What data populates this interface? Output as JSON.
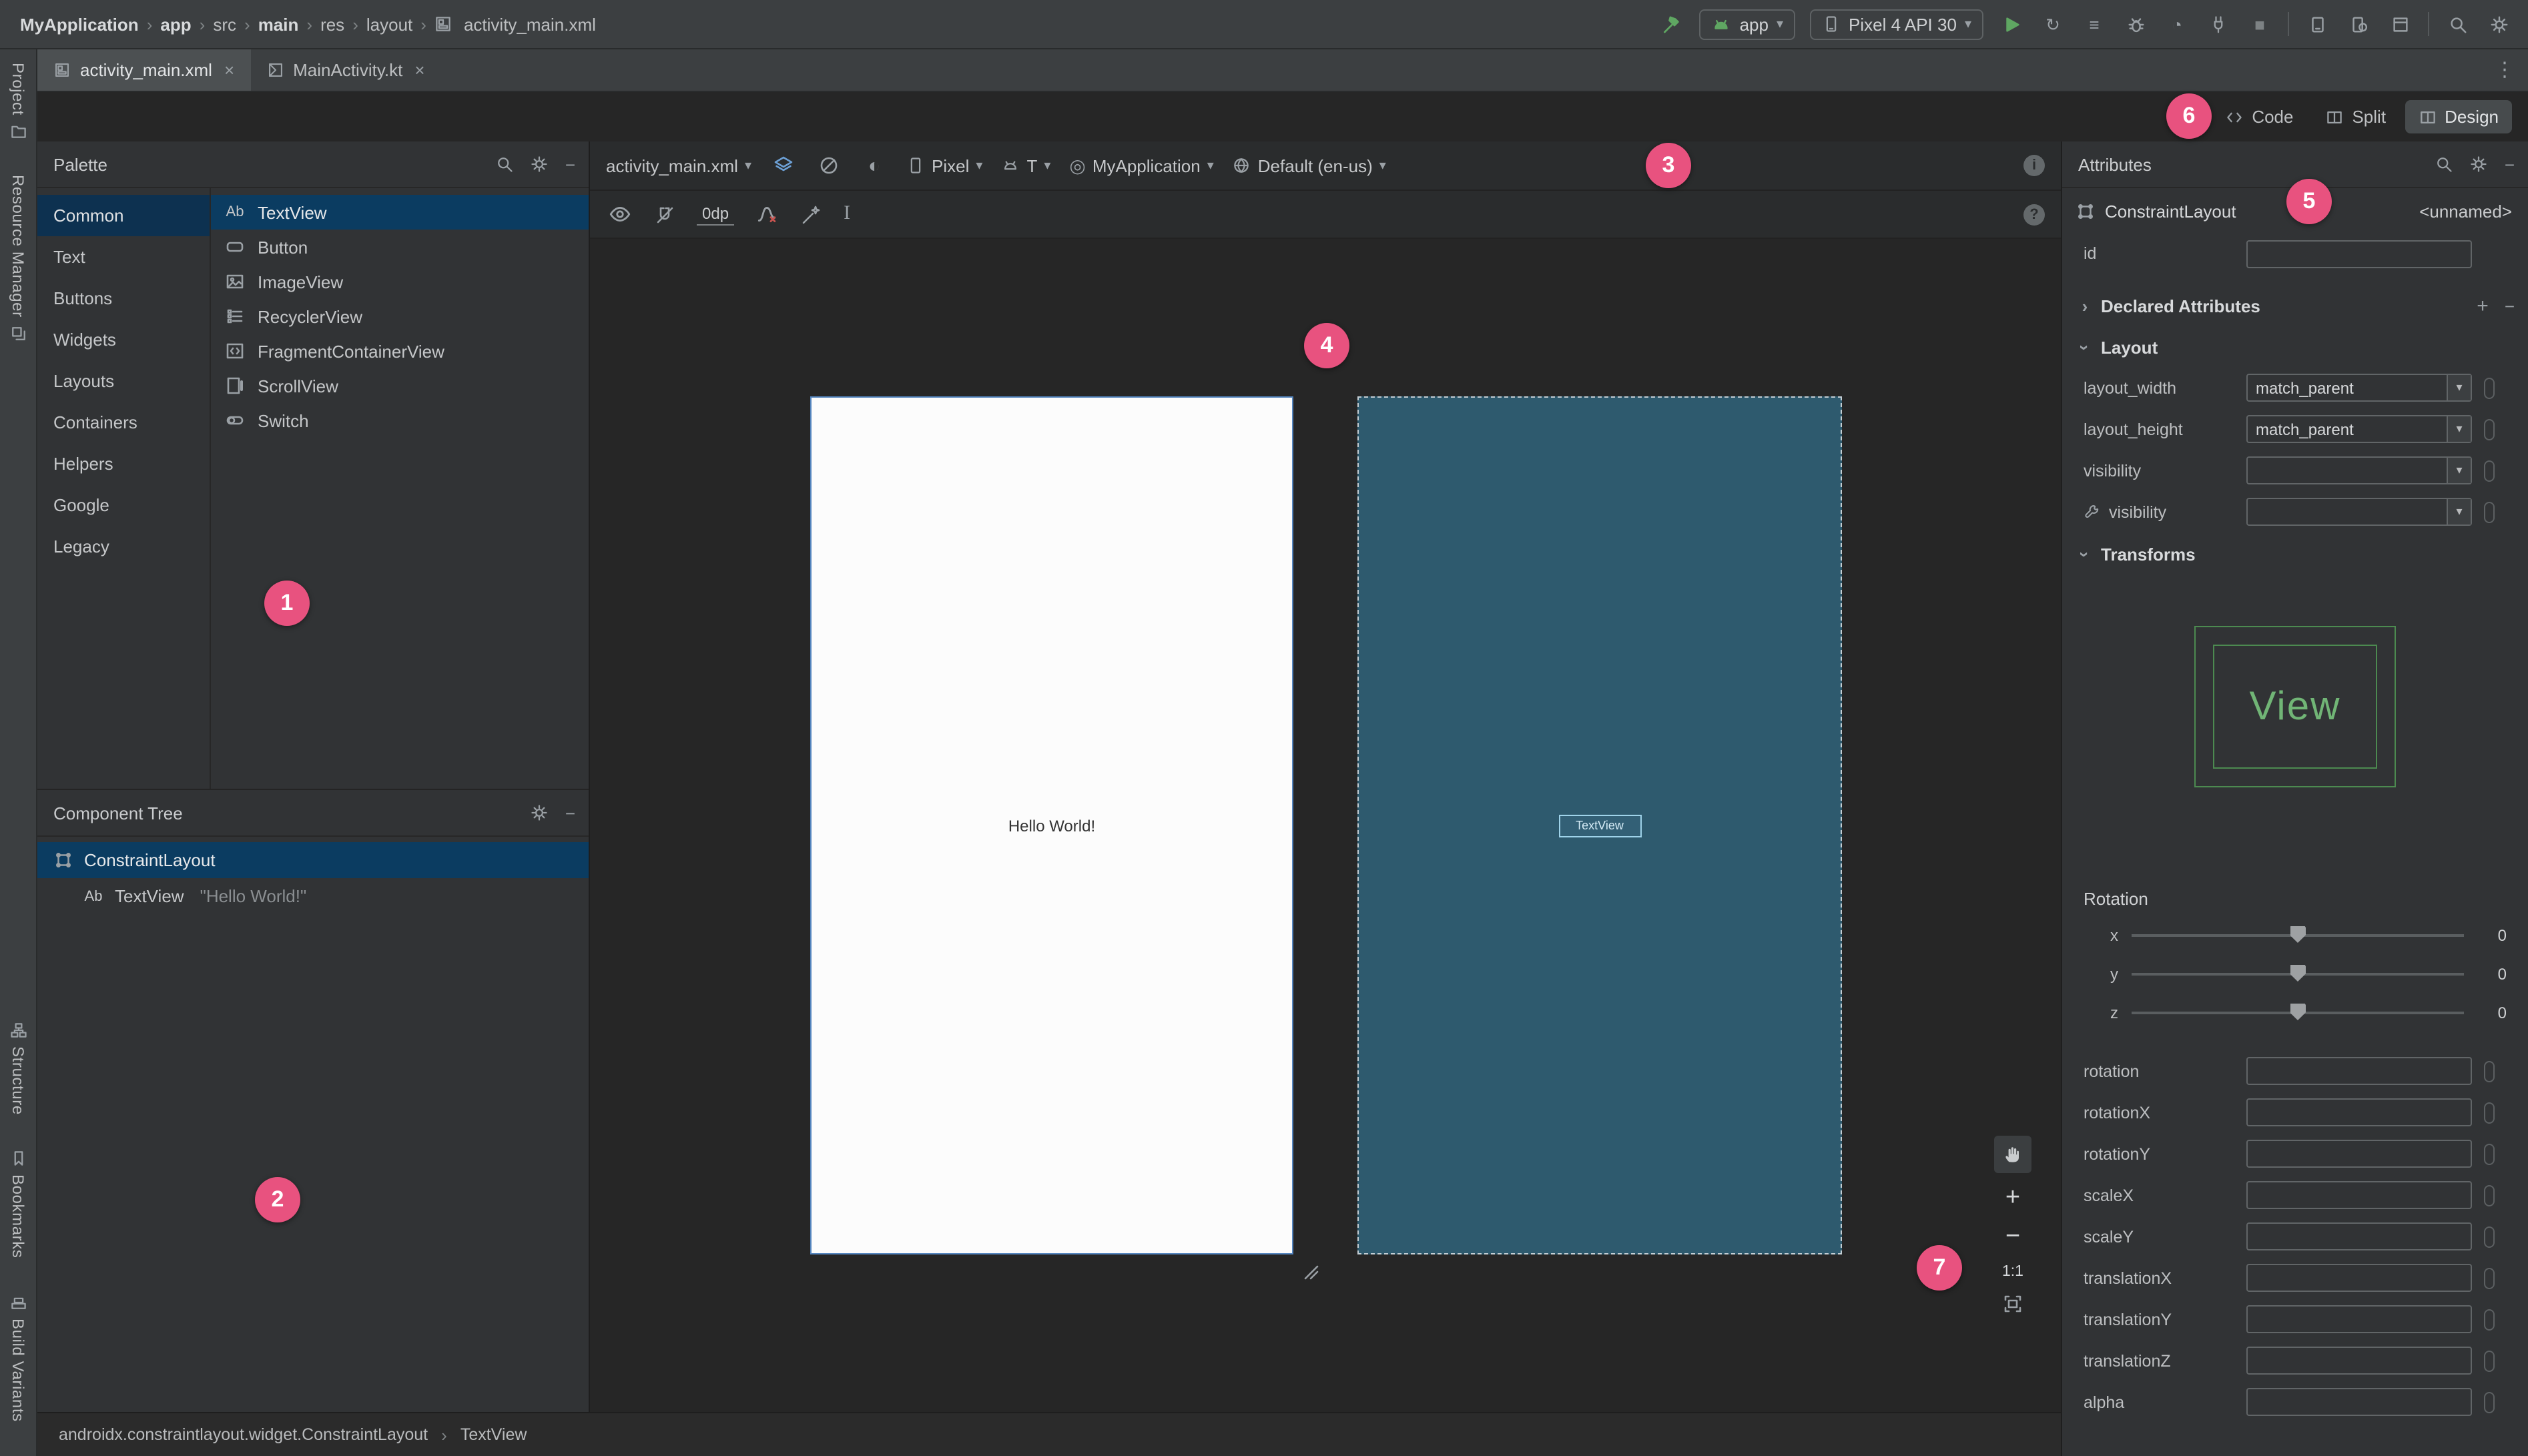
{
  "colors": {
    "badge": "#E8527F",
    "selection": "#0B3C61",
    "selection-dim": "#0D3150",
    "blueprint": "#2E5A6E",
    "panel": "#313335",
    "canvas": "#262626",
    "chrome": "#3C3F41",
    "green": "#5FA762"
  },
  "topbar": {
    "breadcrumbs": [
      {
        "label": "MyApplication",
        "bold": true
      },
      {
        "label": "app",
        "bold": true
      },
      {
        "label": "src",
        "bold": false
      },
      {
        "label": "main",
        "bold": true
      },
      {
        "label": "res",
        "bold": false
      },
      {
        "label": "layout",
        "bold": false
      },
      {
        "label": "activity_main.xml",
        "bold": false
      }
    ],
    "run_config": "app",
    "device": "Pixel 4 API 30"
  },
  "tabs": [
    {
      "label": "activity_main.xml",
      "active": true
    },
    {
      "label": "MainActivity.kt",
      "active": false
    }
  ],
  "left_stripe": {
    "top": [
      "Project",
      "Resource Manager"
    ],
    "bottom": [
      "Structure",
      "Bookmarks",
      "Build Variants"
    ]
  },
  "editor_modes": {
    "code": "Code",
    "split": "Split",
    "design": "Design"
  },
  "design_toolbar": {
    "file": "activity_main.xml",
    "device": "Pixel",
    "api": "T",
    "theme": "MyApplication",
    "locale": "Default (en-us)",
    "default_margin": "0dp"
  },
  "palette": {
    "title": "Palette",
    "categories": [
      "Common",
      "Text",
      "Buttons",
      "Widgets",
      "Layouts",
      "Containers",
      "Helpers",
      "Google",
      "Legacy"
    ],
    "components": [
      "TextView",
      "Button",
      "ImageView",
      "RecyclerView",
      "FragmentContainerView",
      "ScrollView",
      "Switch"
    ]
  },
  "component_tree": {
    "title": "Component Tree",
    "root": "ConstraintLayout",
    "child": "TextView",
    "child_annotation": "\"Hello World!\""
  },
  "canvas": {
    "design_text": "Hello World!",
    "blueprint_label": "TextView",
    "zoom_ratio": "1:1"
  },
  "attributes": {
    "title": "Attributes",
    "component": "ConstraintLayout",
    "component_id": "<unnamed>",
    "id_label": "id",
    "id_value": "",
    "declared": "Declared Attributes",
    "layout_section": "Layout",
    "rows": [
      {
        "label": "layout_width",
        "value": "match_parent"
      },
      {
        "label": "layout_height",
        "value": "match_parent"
      },
      {
        "label": "visibility",
        "value": ""
      },
      {
        "label": "visibility",
        "value": ""
      }
    ],
    "transforms_section": "Transforms",
    "preview_text": "View",
    "rotation_label": "Rotation",
    "sliders": [
      {
        "axis": "x",
        "value": "0"
      },
      {
        "axis": "y",
        "value": "0"
      },
      {
        "axis": "z",
        "value": "0"
      }
    ],
    "fields": [
      "rotation",
      "rotationX",
      "rotationY",
      "scaleX",
      "scaleY",
      "translationX",
      "translationY",
      "translationZ",
      "alpha"
    ]
  },
  "statusbar": {
    "path": "androidx.constraintlayout.widget.ConstraintLayout",
    "selected": "TextView"
  },
  "badges": [
    "1",
    "2",
    "3",
    "4",
    "5",
    "6",
    "7"
  ],
  "glyphs": {
    "dropdown": "▾",
    "crumb_sep": "›",
    "close": "×",
    "kebab": "⋮",
    "minus": "−",
    "plus": "+",
    "chev": "›",
    "help": "?",
    "info": "i",
    "textview_ab": "Ab",
    "pack": "I",
    "apply_changes": "↻",
    "code_changes": "≡",
    "profile": "◔",
    "stop": "■",
    "night": "◐",
    "theme": "◎"
  }
}
